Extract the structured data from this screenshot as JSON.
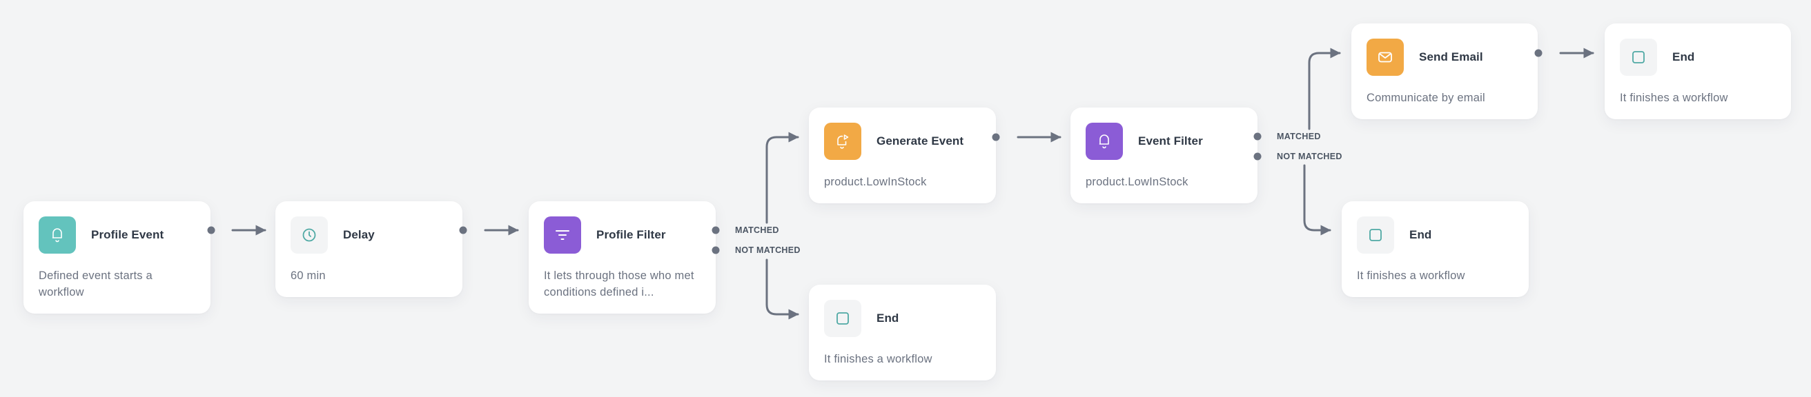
{
  "workflow": {
    "colors": {
      "background": "#f3f4f5",
      "teal": "#63c3bd",
      "purple": "#8b5cd6",
      "orange": "#f2a945",
      "neutral_icon_bg": "#f3f4f5",
      "connector": "#6b7280"
    },
    "nodes": [
      {
        "id": "profile-event",
        "title": "Profile Event",
        "description": "Defined event starts a workflow",
        "icon": "bell-icon",
        "icon_color": "teal"
      },
      {
        "id": "delay",
        "title": "Delay",
        "description": "60 min",
        "icon": "clock-icon",
        "icon_color": "neutral"
      },
      {
        "id": "profile-filter",
        "title": "Profile Filter",
        "description": "It lets through those who met conditions defined i...",
        "icon": "filter-icon",
        "icon_color": "purple"
      },
      {
        "id": "generate-event",
        "title": "Generate Event",
        "description": "product.LowInStock",
        "icon": "bell-play-icon",
        "icon_color": "orange"
      },
      {
        "id": "end-1",
        "title": "End",
        "description": "It finishes a workflow",
        "icon": "square-icon",
        "icon_color": "neutral"
      },
      {
        "id": "event-filter",
        "title": "Event Filter",
        "description": "product.LowInStock",
        "icon": "bell-icon",
        "icon_color": "purple"
      },
      {
        "id": "send-email",
        "title": "Send Email",
        "description": "Communicate by email",
        "icon": "envelope-icon",
        "icon_color": "orange"
      },
      {
        "id": "end-2",
        "title": "End",
        "description": "It finishes a workflow",
        "icon": "square-icon",
        "icon_color": "neutral"
      },
      {
        "id": "end-3",
        "title": "End",
        "description": "It finishes a workflow",
        "icon": "square-icon",
        "icon_color": "neutral"
      }
    ],
    "branch_labels": {
      "matched": "MATCHED",
      "not_matched": "NOT MATCHED"
    },
    "edges": [
      {
        "from": "profile-event",
        "to": "delay"
      },
      {
        "from": "delay",
        "to": "profile-filter"
      },
      {
        "from": "profile-filter",
        "to": "generate-event",
        "branch": "MATCHED"
      },
      {
        "from": "profile-filter",
        "to": "end-1",
        "branch": "NOT MATCHED"
      },
      {
        "from": "generate-event",
        "to": "event-filter"
      },
      {
        "from": "event-filter",
        "to": "send-email",
        "branch": "MATCHED"
      },
      {
        "from": "event-filter",
        "to": "end-3",
        "branch": "NOT MATCHED"
      },
      {
        "from": "send-email",
        "to": "end-2"
      }
    ]
  }
}
